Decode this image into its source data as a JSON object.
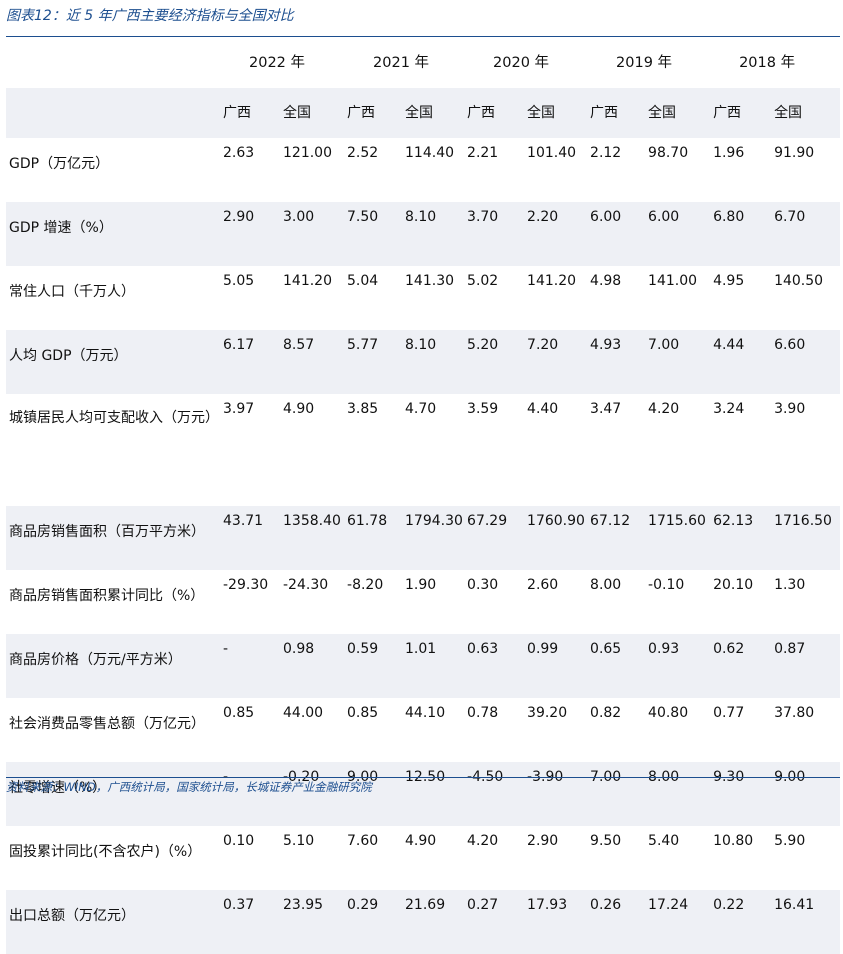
{
  "caption": "图表12：近 5 年广西主要经济指标与全国对比",
  "years": [
    "2022 年",
    "2021 年",
    "2020 年",
    "2019 年",
    "2018 年"
  ],
  "region_labels": [
    "广西",
    "全国"
  ],
  "rows": [
    {
      "label": "GDP（万亿元）",
      "values": [
        "2.63",
        "121.00",
        "2.52",
        "114.40",
        "2.21",
        "101.40",
        "2.12",
        "98.70",
        "1.96",
        "91.90"
      ]
    },
    {
      "label": "GDP 增速（%）",
      "values": [
        "2.90",
        "3.00",
        "7.50",
        "8.10",
        "3.70",
        "2.20",
        "6.00",
        "6.00",
        "6.80",
        "6.70"
      ]
    },
    {
      "label": "常住人口（千万人）",
      "values": [
        "5.05",
        "141.20",
        "5.04",
        "141.30",
        "5.02",
        "141.20",
        "4.98",
        "141.00",
        "4.95",
        "140.50"
      ]
    },
    {
      "label": "人均 GDP（万元）",
      "values": [
        "6.17",
        "8.57",
        "5.77",
        "8.10",
        "5.20",
        "7.20",
        "4.93",
        "7.00",
        "4.44",
        "6.60"
      ]
    },
    {
      "label": "城镇居民人均可支配收入（万元）",
      "values": [
        "3.97",
        "4.90",
        "3.85",
        "4.70",
        "3.59",
        "4.40",
        "3.47",
        "4.20",
        "3.24",
        "3.90"
      ]
    },
    {
      "label": "商品房销售面积（百万平方米）",
      "values": [
        "43.71",
        "1358.40",
        "61.78",
        "1794.30",
        "67.29",
        "1760.90",
        "67.12",
        "1715.60",
        "62.13",
        "1716.50"
      ]
    },
    {
      "label": "商品房销售面积累计同比（%）",
      "values": [
        "-29.30",
        "-24.30",
        "-8.20",
        "1.90",
        "0.30",
        "2.60",
        "8.00",
        "-0.10",
        "20.10",
        "1.30"
      ]
    },
    {
      "label": "商品房价格（万元/平方米）",
      "values": [
        "-",
        "0.98",
        "0.59",
        "1.01",
        "0.63",
        "0.99",
        "0.65",
        "0.93",
        "0.62",
        "0.87"
      ]
    },
    {
      "label": "社会消费品零售总额（万亿元）",
      "values": [
        "0.85",
        "44.00",
        "0.85",
        "44.10",
        "0.78",
        "39.20",
        "0.82",
        "40.80",
        "0.77",
        "37.80"
      ]
    },
    {
      "label": "社零增速（%）",
      "values": [
        "-",
        "-0.20",
        "9.00",
        "12.50",
        "-4.50",
        "-3.90",
        "7.00",
        "8.00",
        "9.30",
        "9.00"
      ]
    },
    {
      "label": "固投累计同比(不含农户)（%）",
      "values": [
        "0.10",
        "5.10",
        "7.60",
        "4.90",
        "4.20",
        "2.90",
        "9.50",
        "5.40",
        "10.80",
        "5.90"
      ]
    },
    {
      "label": "出口总额（万亿元）",
      "values": [
        "0.37",
        "23.95",
        "0.29",
        "21.69",
        "0.27",
        "17.93",
        "0.26",
        "17.24",
        "0.22",
        "16.41"
      ]
    }
  ],
  "source": "资料来源：WIND，广西统计局，国家统计局，长城证券产业金融研究院",
  "colors": {
    "accent": "#1c4e8f",
    "stripe": "#eef0f5"
  }
}
